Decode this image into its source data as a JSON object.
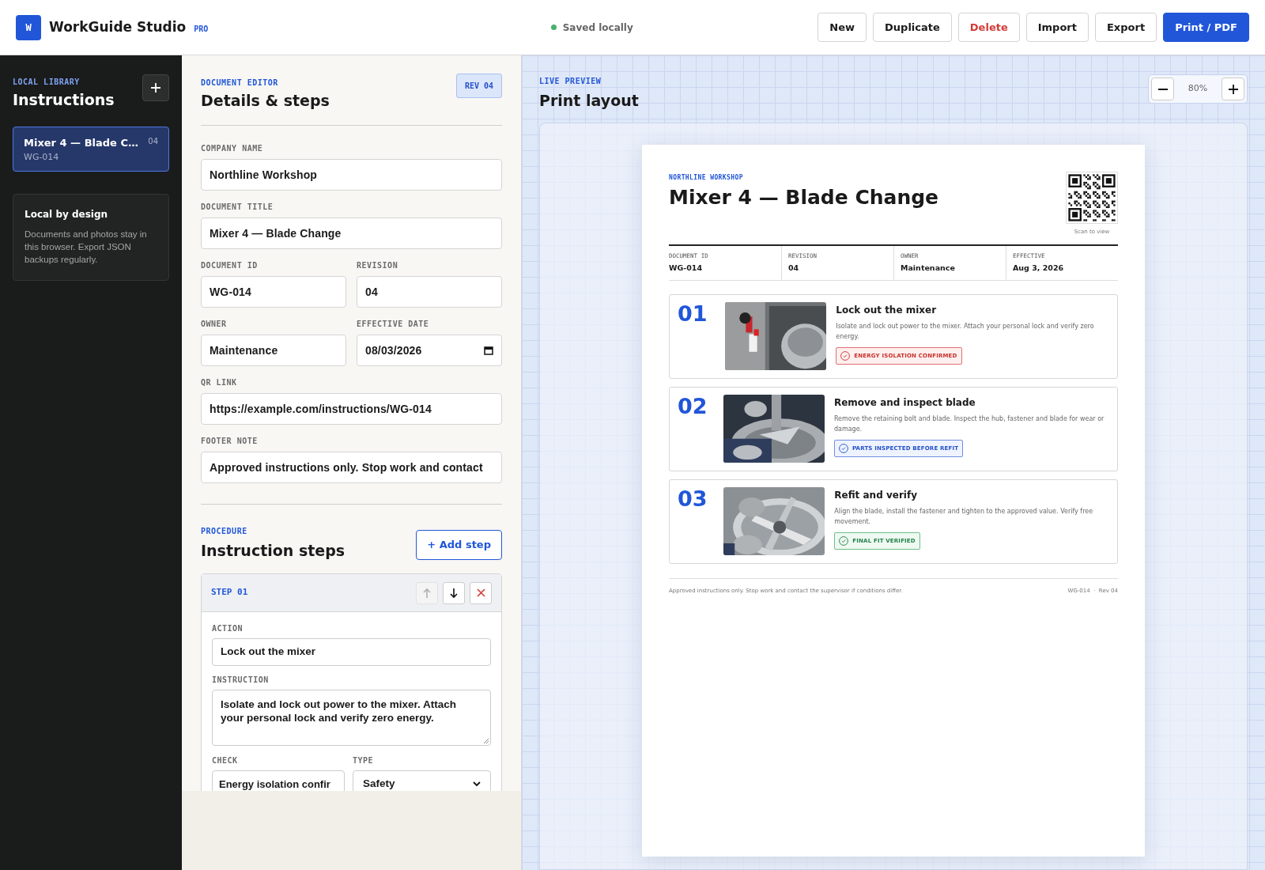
{
  "header": {
    "logo_letter": "W",
    "app_name": "WorkGuide Studio",
    "plan_badge": "PRO",
    "save_status": "Saved locally",
    "buttons": [
      {
        "label": "New",
        "kind": "default"
      },
      {
        "label": "Duplicate",
        "kind": "default"
      },
      {
        "label": "Delete",
        "kind": "danger"
      },
      {
        "label": "Import",
        "kind": "default"
      },
      {
        "label": "Export",
        "kind": "default"
      },
      {
        "label": "Print / PDF",
        "kind": "primary"
      }
    ]
  },
  "sidebar": {
    "eyebrow": "LOCAL LIBRARY",
    "title": "Instructions",
    "items": [
      {
        "title": "Mixer 4 — Blade C…",
        "id": "WG-014",
        "revision": "04",
        "selected": true
      }
    ],
    "note": {
      "title": "Local by design",
      "text": "Documents and photos stay in this browser. Export JSON backups regularly."
    }
  },
  "editor": {
    "eyebrow": "DOCUMENT EDITOR",
    "title": "Details & steps",
    "rev_badge": "REV 04",
    "field_rows": [
      [
        {
          "label": "COMPANY NAME",
          "value": "Northline Workshop",
          "kind": "text"
        }
      ],
      [
        {
          "label": "DOCUMENT TITLE",
          "value": "Mixer 4 — Blade Change",
          "kind": "text"
        }
      ],
      [
        {
          "label": "DOCUMENT ID",
          "value": "WG-014",
          "kind": "text"
        },
        {
          "label": "REVISION",
          "value": "04",
          "kind": "text"
        }
      ],
      [
        {
          "label": "OWNER",
          "value": "Maintenance",
          "kind": "text"
        },
        {
          "label": "EFFECTIVE DATE",
          "value": "08/03/2026",
          "kind": "date"
        }
      ],
      [
        {
          "label": "QR LINK",
          "value": "https://example.com/instructions/WG-014",
          "kind": "text"
        }
      ],
      [
        {
          "label": "FOOTER NOTE",
          "value": "Approved instructions only. Stop work and contact",
          "kind": "text"
        }
      ]
    ],
    "procedure": {
      "eyebrow": "PROCEDURE",
      "title": "Instruction steps",
      "add_button": "+ Add step",
      "step": {
        "label": "STEP 01",
        "move_up_disabled": true,
        "move_down_disabled": false,
        "action_label": "ACTION",
        "action": "Lock out the mixer",
        "instruction_label": "INSTRUCTION",
        "instruction": "Isolate and lock out power to the mixer. Attach your personal lock and verify zero energy.",
        "check_label": "CHECK",
        "check": "Energy isolation confir",
        "type_label": "TYPE",
        "type": "Safety"
      }
    }
  },
  "preview": {
    "eyebrow": "LIVE PREVIEW",
    "title": "Print layout",
    "zoom": "80%",
    "page": {
      "company": "NORTHLINE WORKSHOP",
      "title": "Mixer 4 — Blade Change",
      "qr_caption": "Scan to view",
      "meta": [
        {
          "label": "DOCUMENT ID",
          "value": "WG-014"
        },
        {
          "label": "REVISION",
          "value": "04"
        },
        {
          "label": "OWNER",
          "value": "Maintenance"
        },
        {
          "label": "EFFECTIVE",
          "value": "Aug 3, 2026"
        }
      ],
      "steps": [
        {
          "number": "01",
          "title": "Lock out the mixer",
          "text": "Isolate and lock out power to the mixer. Attach your personal lock and verify zero energy.",
          "check": "ENERGY ISOLATION CONFIRMED",
          "kind": "safety"
        },
        {
          "number": "02",
          "title": "Remove and inspect blade",
          "text": "Remove the retaining bolt and blade. Inspect the hub, fastener and blade for wear or damage.",
          "check": "PARTS INSPECTED BEFORE REFIT",
          "kind": "quality"
        },
        {
          "number": "03",
          "title": "Refit and verify",
          "text": "Align the blade, install the fastener and tighten to the approved value. Verify free movement.",
          "check": "FINAL FIT VERIFIED",
          "kind": "verify"
        }
      ],
      "footer_note": "Approved instructions only. Stop work and contact the supervisor if conditions differ.",
      "footer_ref": "WG-014  ·  Rev 04"
    }
  }
}
